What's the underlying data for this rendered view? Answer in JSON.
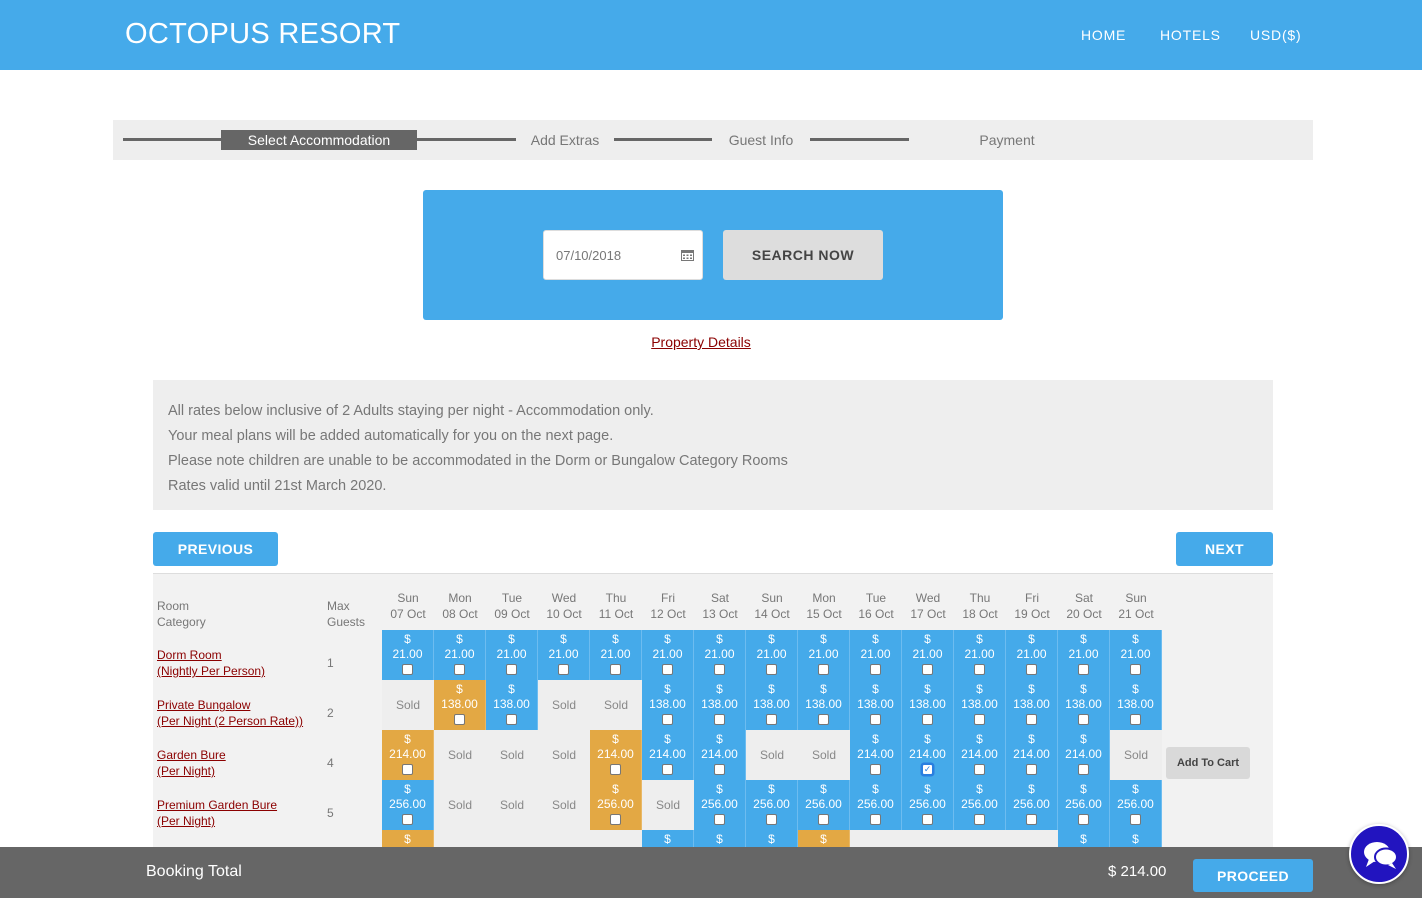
{
  "header": {
    "brand": "OCTOPUS RESORT",
    "nav": [
      "HOME",
      "HOTELS",
      "USD($)"
    ]
  },
  "steps": [
    "Select Accommodation",
    "Add Extras",
    "Guest Info",
    "Payment"
  ],
  "search": {
    "date_value": "07/10/2018",
    "button": "SEARCH NOW"
  },
  "property_link": "Property Details",
  "notice": [
    "All rates below inclusive of 2 Adults staying per night - Accommodation only.",
    "Your meal plans will be added automatically for you on the next page.",
    "Please note children are unable to be accommodated in the Dorm or Bungalow Category Rooms",
    "Rates valid until 21st March 2020."
  ],
  "pager": {
    "previous": "PREVIOUS",
    "next": "NEXT"
  },
  "grid": {
    "col_room": [
      "Room",
      "Category"
    ],
    "col_guests": [
      "Max",
      "Guests"
    ],
    "days": [
      {
        "dow": "Sun",
        "date": "07 Oct"
      },
      {
        "dow": "Mon",
        "date": "08 Oct"
      },
      {
        "dow": "Tue",
        "date": "09 Oct"
      },
      {
        "dow": "Wed",
        "date": "10 Oct"
      },
      {
        "dow": "Thu",
        "date": "11 Oct"
      },
      {
        "dow": "Fri",
        "date": "12 Oct"
      },
      {
        "dow": "Sat",
        "date": "13 Oct"
      },
      {
        "dow": "Sun",
        "date": "14 Oct"
      },
      {
        "dow": "Mon",
        "date": "15 Oct"
      },
      {
        "dow": "Tue",
        "date": "16 Oct"
      },
      {
        "dow": "Wed",
        "date": "17 Oct"
      },
      {
        "dow": "Thu",
        "date": "18 Oct"
      },
      {
        "dow": "Fri",
        "date": "19 Oct"
      },
      {
        "dow": "Sat",
        "date": "20 Oct"
      },
      {
        "dow": "Sun",
        "date": "21 Oct"
      }
    ],
    "currency": "$",
    "sold_label": "Sold",
    "add_to_cart": "Add To Cart",
    "rooms": [
      {
        "name": [
          "Dorm Room",
          "(Nightly Per Person)"
        ],
        "guests": "1",
        "cells": [
          {
            "s": "a",
            "p": "21.00"
          },
          {
            "s": "a",
            "p": "21.00"
          },
          {
            "s": "a",
            "p": "21.00"
          },
          {
            "s": "a",
            "p": "21.00"
          },
          {
            "s": "a",
            "p": "21.00"
          },
          {
            "s": "a",
            "p": "21.00"
          },
          {
            "s": "a",
            "p": "21.00"
          },
          {
            "s": "a",
            "p": "21.00"
          },
          {
            "s": "a",
            "p": "21.00"
          },
          {
            "s": "a",
            "p": "21.00"
          },
          {
            "s": "a",
            "p": "21.00"
          },
          {
            "s": "a",
            "p": "21.00"
          },
          {
            "s": "a",
            "p": "21.00"
          },
          {
            "s": "a",
            "p": "21.00"
          },
          {
            "s": "a",
            "p": "21.00"
          }
        ]
      },
      {
        "name": [
          "Private Bungalow",
          "(Per Night (2 Person Rate))"
        ],
        "guests": "2",
        "cells": [
          {
            "s": "sold"
          },
          {
            "s": "o",
            "p": "138.00"
          },
          {
            "s": "a",
            "p": "138.00"
          },
          {
            "s": "sold"
          },
          {
            "s": "sold"
          },
          {
            "s": "a",
            "p": "138.00"
          },
          {
            "s": "a",
            "p": "138.00"
          },
          {
            "s": "a",
            "p": "138.00"
          },
          {
            "s": "a",
            "p": "138.00"
          },
          {
            "s": "a",
            "p": "138.00"
          },
          {
            "s": "a",
            "p": "138.00"
          },
          {
            "s": "a",
            "p": "138.00"
          },
          {
            "s": "a",
            "p": "138.00"
          },
          {
            "s": "a",
            "p": "138.00"
          },
          {
            "s": "a",
            "p": "138.00"
          }
        ]
      },
      {
        "name": [
          "Garden Bure",
          "(Per Night)"
        ],
        "guests": "4",
        "cells": [
          {
            "s": "o",
            "p": "214.00"
          },
          {
            "s": "sold"
          },
          {
            "s": "sold"
          },
          {
            "s": "sold"
          },
          {
            "s": "o",
            "p": "214.00"
          },
          {
            "s": "a",
            "p": "214.00"
          },
          {
            "s": "a",
            "p": "214.00"
          },
          {
            "s": "sold"
          },
          {
            "s": "sold"
          },
          {
            "s": "a",
            "p": "214.00"
          },
          {
            "s": "a",
            "p": "214.00",
            "checked": true
          },
          {
            "s": "a",
            "p": "214.00"
          },
          {
            "s": "a",
            "p": "214.00"
          },
          {
            "s": "a",
            "p": "214.00"
          },
          {
            "s": "sold"
          }
        ]
      },
      {
        "name": [
          "Premium Garden Bure",
          "(Per Night)"
        ],
        "guests": "5",
        "cells": [
          {
            "s": "a",
            "p": "256.00"
          },
          {
            "s": "sold"
          },
          {
            "s": "sold"
          },
          {
            "s": "sold"
          },
          {
            "s": "o",
            "p": "256.00"
          },
          {
            "s": "sold"
          },
          {
            "s": "a",
            "p": "256.00"
          },
          {
            "s": "a",
            "p": "256.00"
          },
          {
            "s": "a",
            "p": "256.00"
          },
          {
            "s": "a",
            "p": "256.00"
          },
          {
            "s": "a",
            "p": "256.00"
          },
          {
            "s": "a",
            "p": "256.00"
          },
          {
            "s": "a",
            "p": "256.00"
          },
          {
            "s": "a",
            "p": "256.00"
          },
          {
            "s": "a",
            "p": "256.00"
          }
        ]
      },
      {
        "name": [
          "",
          ""
        ],
        "guests": "",
        "cells": [
          {
            "s": "o",
            "p": ""
          },
          {
            "s": "sold"
          },
          {
            "s": "sold"
          },
          {
            "s": "sold"
          },
          {
            "s": "sold"
          },
          {
            "s": "a",
            "p": ""
          },
          {
            "s": "a",
            "p": ""
          },
          {
            "s": "a",
            "p": ""
          },
          {
            "s": "o",
            "p": ""
          },
          {
            "s": "sold"
          },
          {
            "s": "sold"
          },
          {
            "s": "sold"
          },
          {
            "s": "sold"
          },
          {
            "s": "a",
            "p": ""
          },
          {
            "s": "a",
            "p": ""
          }
        ]
      }
    ]
  },
  "footer": {
    "label": "Booking Total",
    "total": "$ 214.00",
    "proceed": "PROCEED"
  },
  "colors": {
    "primary": "#45aaea",
    "special": "#e3a844",
    "link": "#8b0000",
    "footer": "#666666",
    "chat": "#2214bf"
  },
  "icons": {
    "calendar": "calendar-icon",
    "chat": "chat-bubbles-icon"
  }
}
